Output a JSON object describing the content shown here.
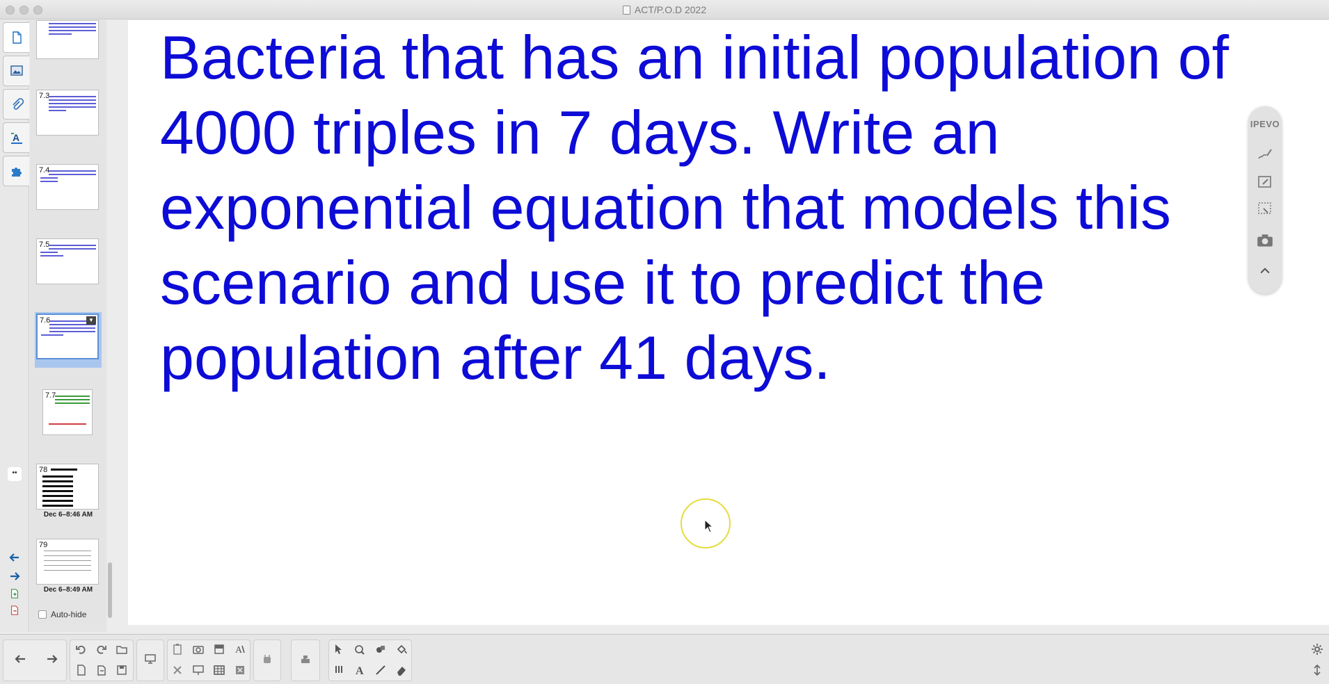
{
  "window": {
    "title": "ACT/P.O.D 2022"
  },
  "tabs": [
    {
      "name": "page-sorter",
      "icon": "page-icon"
    },
    {
      "name": "gallery",
      "icon": "gallery-icon"
    },
    {
      "name": "attachments",
      "icon": "paperclip-icon"
    },
    {
      "name": "properties",
      "icon": "properties-icon"
    },
    {
      "name": "addons",
      "icon": "puzzle-icon"
    }
  ],
  "sorter": {
    "pages": [
      {
        "num": "",
        "date": ""
      },
      {
        "num": "7.3",
        "date": ""
      },
      {
        "num": "7.4",
        "date": ""
      },
      {
        "num": "7.5",
        "date": ""
      },
      {
        "num": "7.6",
        "date": ""
      },
      {
        "num": "7.7",
        "date": ""
      },
      {
        "num": "78",
        "date": "Dec 6–8:46 AM"
      },
      {
        "num": "79",
        "date": "Dec 6–8:49 AM"
      }
    ],
    "autohide_label": "Auto-hide",
    "collapse_label": "••"
  },
  "slide": {
    "lines": [
      "Bacteria that has an initial population of",
      "4000 triples in 7 days. Write an",
      "exponential equation that models this",
      "scenario and use it to predict the",
      "population after 41 days."
    ]
  },
  "ipevo": {
    "label": "IPEVO"
  },
  "colors": {
    "slide_text": "#0d0bd6",
    "selected_thumb": "#a9c6ee",
    "cursor_ring": "#e6dc3c"
  }
}
